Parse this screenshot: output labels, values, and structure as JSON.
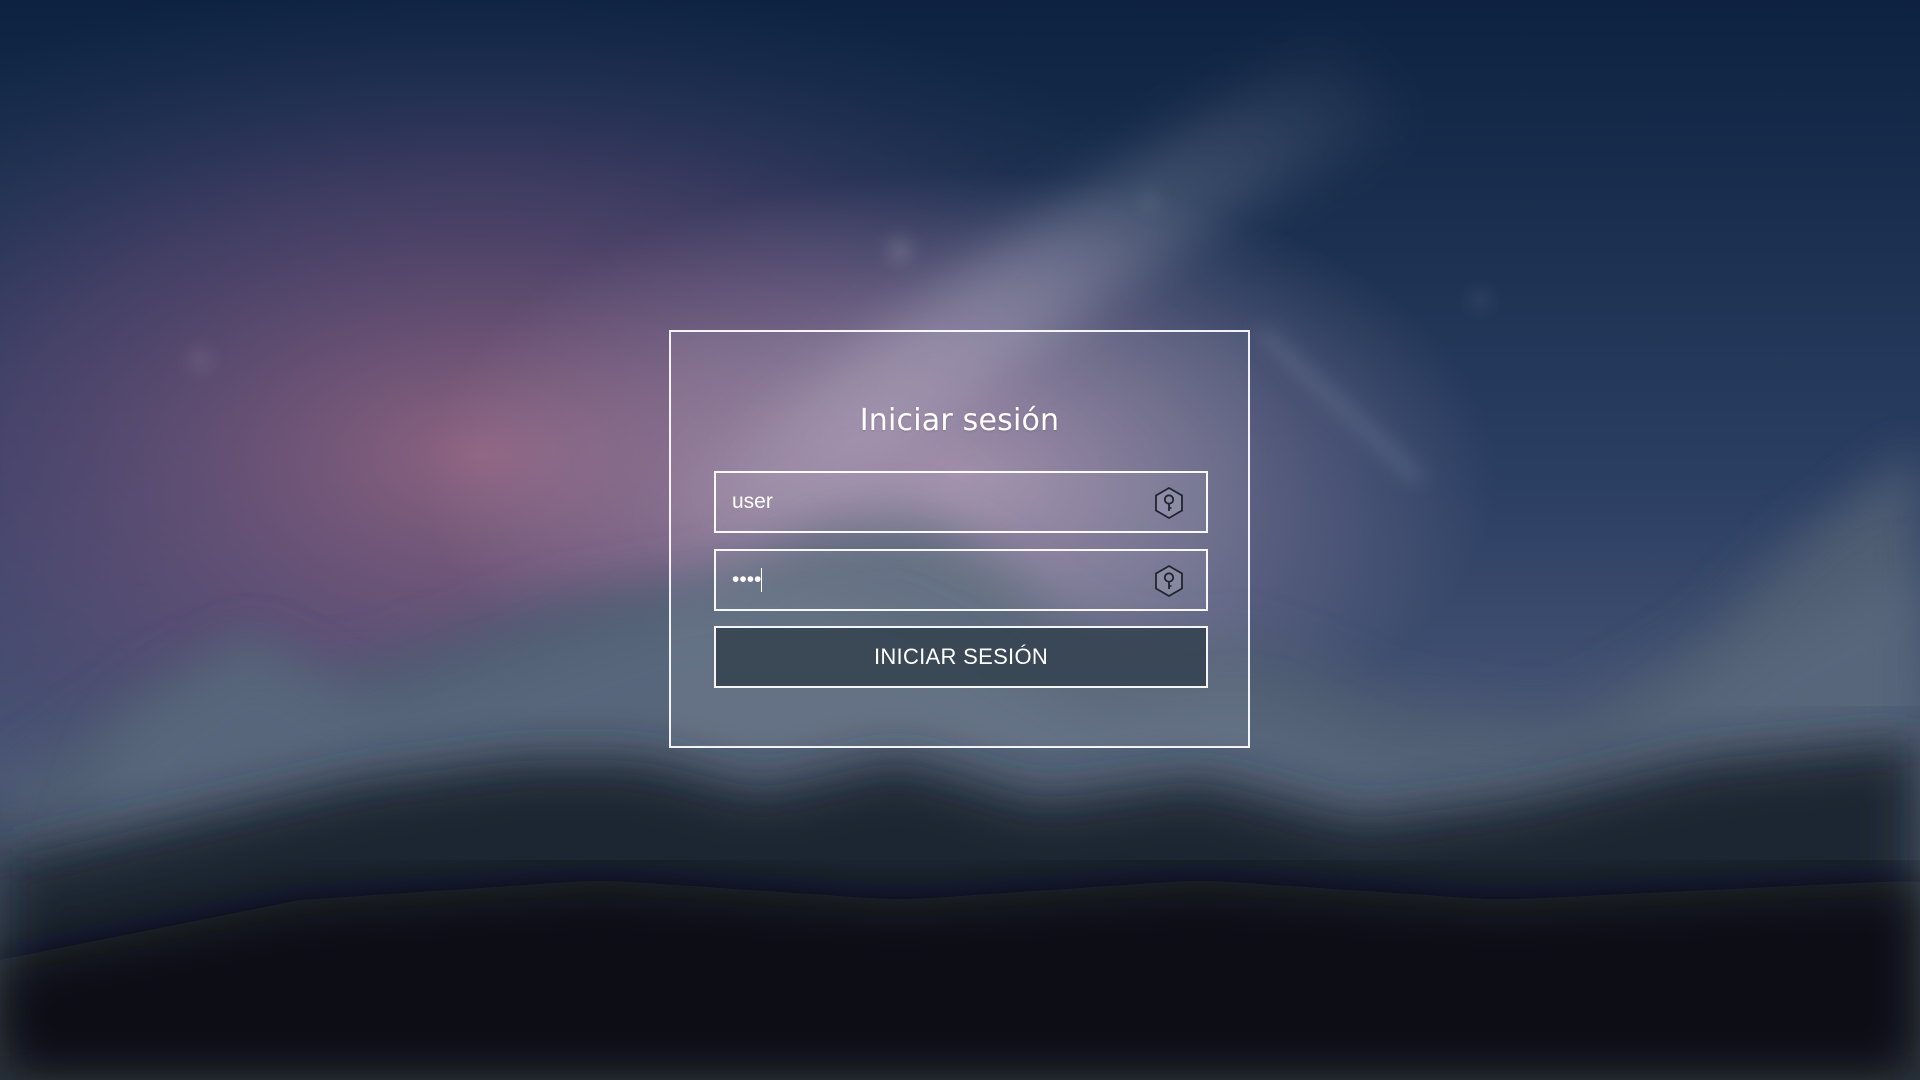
{
  "login": {
    "title": "Iniciar sesión",
    "username": {
      "value": "user",
      "icon": "key-hexagon-icon"
    },
    "password": {
      "value": "••••",
      "icon": "key-hexagon-icon"
    },
    "submit_label": "INICIAR SESIÓN"
  },
  "theme": {
    "panel_border": "#ffffff",
    "button_fill": "#303e4a",
    "text": "#ffffff"
  }
}
